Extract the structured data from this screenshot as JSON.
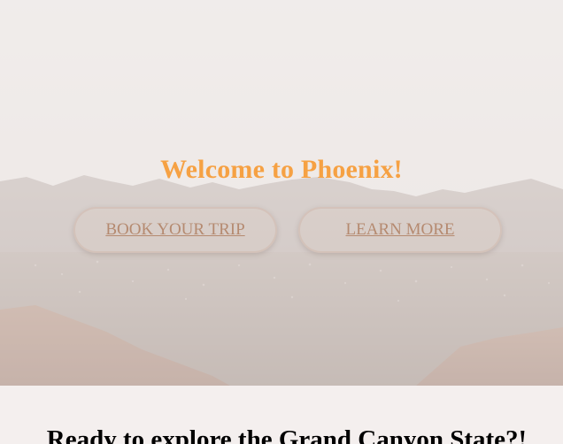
{
  "hero": {
    "title": "Welcome to Phoenix!",
    "background_image": "mountain-city-landscape",
    "title_color": "#f6a143"
  },
  "buttons": {
    "book_trip": "BOOK YOUR TRIP",
    "learn_more": "LEARN MORE",
    "text_color": "#b58a70"
  },
  "tagline": {
    "text": "Ready to explore the Grand Canyon State?!"
  }
}
